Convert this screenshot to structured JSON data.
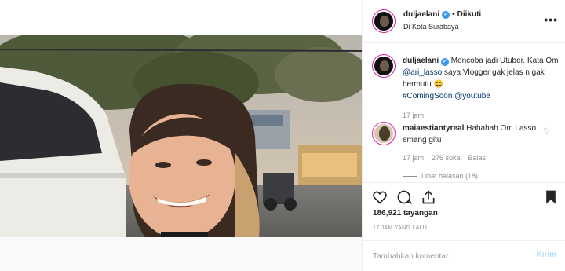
{
  "post": {
    "username": "duljaelani",
    "verified_mark": "✓",
    "separator": "•",
    "follow_state": "Diikuti",
    "location": "Di Kota Surabaya",
    "more_icon": "more-horizontal-icon"
  },
  "caption": {
    "username": "duljaelani",
    "text_plain_1": "Mencoba jadi Utuber. Kata Om ",
    "mention_1": "@ari_lasso",
    "text_plain_2": " saya Vlogger gak jelas n gak bermutu 😄",
    "hashtag": "#ComingSoon",
    "mention_2": "@youtube",
    "time": "17 jam"
  },
  "comment": {
    "username": "maiaestiantyreal",
    "text": "Hahahah Om Lasso emang gitu",
    "time": "17 jam",
    "likes": "276 suka",
    "reply": "Balas",
    "view_replies": "Lihat balasan (18)"
  },
  "actions": {
    "like_icon": "heart-icon",
    "comment_icon": "comment-icon",
    "share_icon": "share-icon",
    "save_icon": "bookmark-icon"
  },
  "stats": {
    "views_number": "186,921",
    "views_label": "tayangan",
    "time_ago": "17 JAM YANG LALU"
  },
  "add_comment": {
    "placeholder": "Tambahkan komentar...",
    "post_label": "Kirim"
  },
  "colors": {
    "link": "#003569",
    "verified": "#3897f0",
    "post_button_disabled": "#b2dffc",
    "muted": "#8e8e8e"
  }
}
